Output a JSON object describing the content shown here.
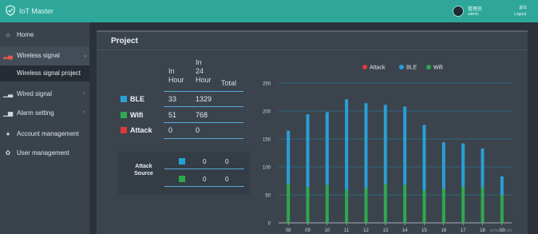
{
  "app": {
    "title": "IoT Master"
  },
  "user": {
    "name": "管理员",
    "role": "admin",
    "top_right": "退出",
    "logout": "Logout"
  },
  "sidebar": {
    "items": [
      {
        "label": "Home",
        "icon": "home-icon"
      },
      {
        "label": "Wireless signal",
        "icon": "signal-icon"
      },
      {
        "label": "Wired signal",
        "icon": "wired-icon"
      },
      {
        "label": "Alarm setting",
        "icon": "alarm-icon"
      },
      {
        "label": "Account management",
        "icon": "account-icon"
      },
      {
        "label": "User management",
        "icon": "user-icon"
      }
    ],
    "sub_item": "Wireless signal project"
  },
  "panel": {
    "title": "Project"
  },
  "stats": {
    "headers": {
      "h1": "In\nHour",
      "h2": "In\n24\nHour",
      "h3": "Total"
    },
    "rows": [
      {
        "label": "BLE",
        "color": "#2a9fd6",
        "hour": "33",
        "day": "1329",
        "total": ""
      },
      {
        "label": "Wifi",
        "color": "#2fa84f",
        "hour": "51",
        "day": "768",
        "total": ""
      },
      {
        "label": "Attack",
        "color": "#e03a3a",
        "hour": "0",
        "day": "0",
        "total": ""
      }
    ],
    "attack_source": {
      "label": "Attack\nSource",
      "rows": [
        {
          "color": "#2a9fd6",
          "a": "0",
          "b": "0"
        },
        {
          "color": "#2fa84f",
          "a": "0",
          "b": "0"
        }
      ]
    }
  },
  "chart_data": {
    "type": "bar",
    "stacked": true,
    "categories": [
      "08",
      "09",
      "10",
      "11",
      "12",
      "13",
      "14",
      "15",
      "16",
      "17",
      "18",
      "19"
    ],
    "series": [
      {
        "name": "Attack",
        "color": "#e03a3a",
        "values": [
          0,
          0,
          0,
          0,
          0,
          0,
          0,
          0,
          0,
          0,
          0,
          0
        ]
      },
      {
        "name": "BLE",
        "color": "#2a9fd6",
        "values": [
          95,
          130,
          130,
          162,
          152,
          142,
          140,
          117,
          83,
          77,
          70,
          33
        ]
      },
      {
        "name": "Wifi",
        "color": "#2fa84f",
        "values": [
          70,
          64,
          68,
          59,
          62,
          69,
          68,
          58,
          61,
          65,
          63,
          50
        ]
      }
    ],
    "yticks": [
      0,
      50,
      100,
      150,
      200,
      250
    ],
    "ylim": [
      0,
      250
    ],
    "legend_position": "top-right",
    "grid": true,
    "watermark": "echarts.com"
  }
}
